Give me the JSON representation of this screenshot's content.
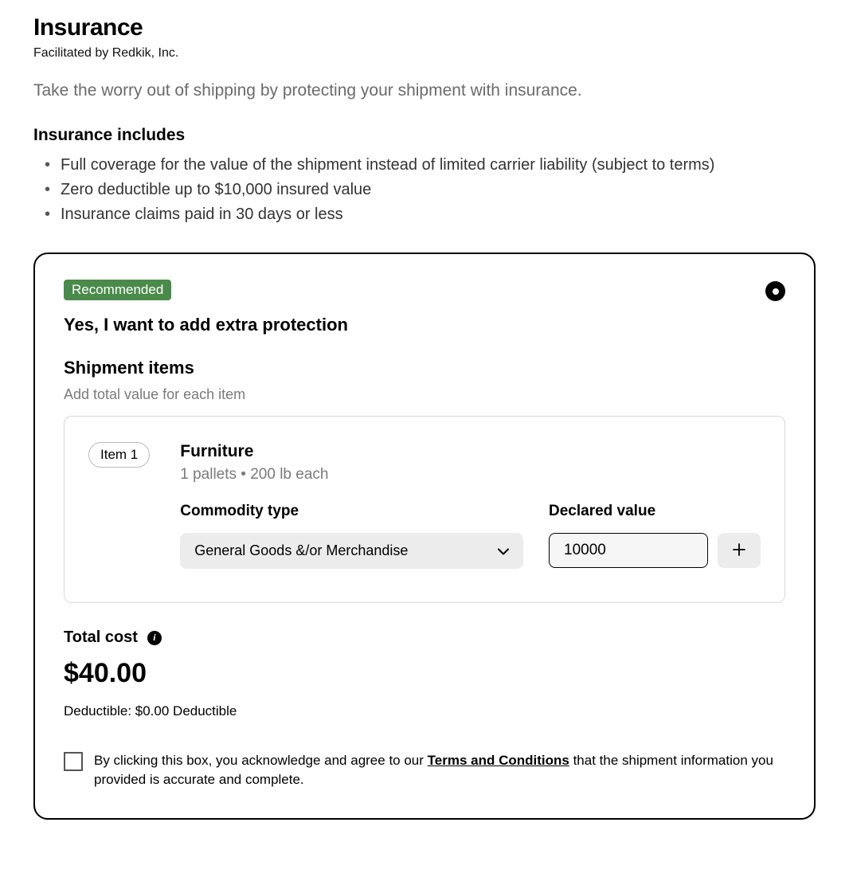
{
  "header": {
    "title": "Insurance",
    "facilitator": "Facilitated by Redkik, Inc.",
    "intro": "Take the worry out of shipping by protecting your shipment with insurance."
  },
  "includes": {
    "title": "Insurance includes",
    "items": [
      "Full coverage for the value of the shipment instead of limited carrier liability (subject to terms)",
      "Zero deductible up to $10,000 insured value",
      "Insurance claims paid in 30 days or less"
    ]
  },
  "card": {
    "badge": "Recommended",
    "title": "Yes, I want to add extra protection",
    "shipment": {
      "title": "Shipment items",
      "subtitle": "Add total value for each item",
      "item": {
        "pill": "Item 1",
        "name": "Furniture",
        "meta": "1 pallets   •   200 lb each",
        "commodity_label": "Commodity type",
        "commodity_value": "General Goods &/or Merchandise",
        "declared_label": "Declared value",
        "declared_value": "10000"
      }
    },
    "total": {
      "label": "Total cost",
      "amount": "$40.00",
      "deductible": "Deductible: $0.00 Deductible"
    },
    "terms": {
      "prefix": "By clicking this box, you acknowledge and agree to our ",
      "link": "Terms and Conditions",
      "suffix": " that the shipment information you provided is accurate and complete."
    }
  }
}
